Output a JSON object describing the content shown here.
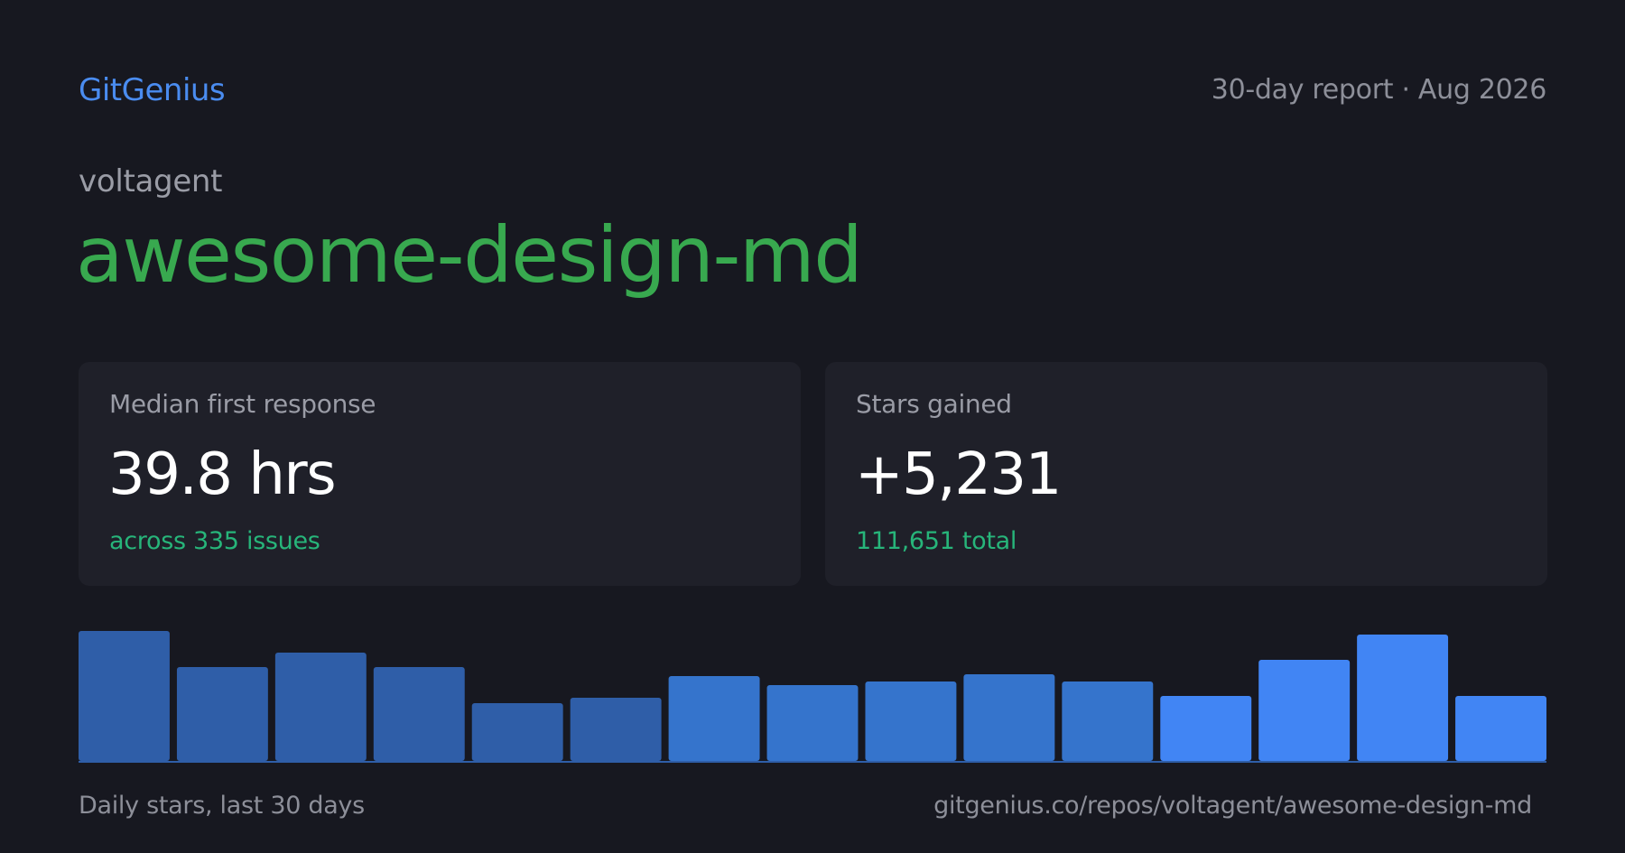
{
  "header": {
    "brand": "GitGenius",
    "report_meta": "30-day report · Aug 2026"
  },
  "repo": {
    "owner": "voltagent",
    "name": "awesome-design-md"
  },
  "cards": [
    {
      "label": "Median first response",
      "value": "39.8 hrs",
      "sub": "across 335 issues"
    },
    {
      "label": "Stars gained",
      "value": "+5,231",
      "sub": "111,651 total"
    }
  ],
  "chart_data": {
    "type": "bar",
    "values": [
      72,
      52,
      60,
      52,
      32,
      35,
      47,
      42,
      44,
      48,
      44,
      36,
      56,
      70,
      36
    ],
    "colors": [
      "#2f5ea8",
      "#2f5ea8",
      "#2f5ea8",
      "#2f5ea8",
      "#2f5ea8",
      "#2f5ea8",
      "#3574cc",
      "#3574cc",
      "#3574cc",
      "#3574cc",
      "#3574cc",
      "#4185f4",
      "#4185f4",
      "#4185f4",
      "#4185f4"
    ],
    "caption": "Daily stars, last 30 days"
  },
  "footer": {
    "url": "gitgenius.co/repos/voltagent/awesome-design-md"
  }
}
